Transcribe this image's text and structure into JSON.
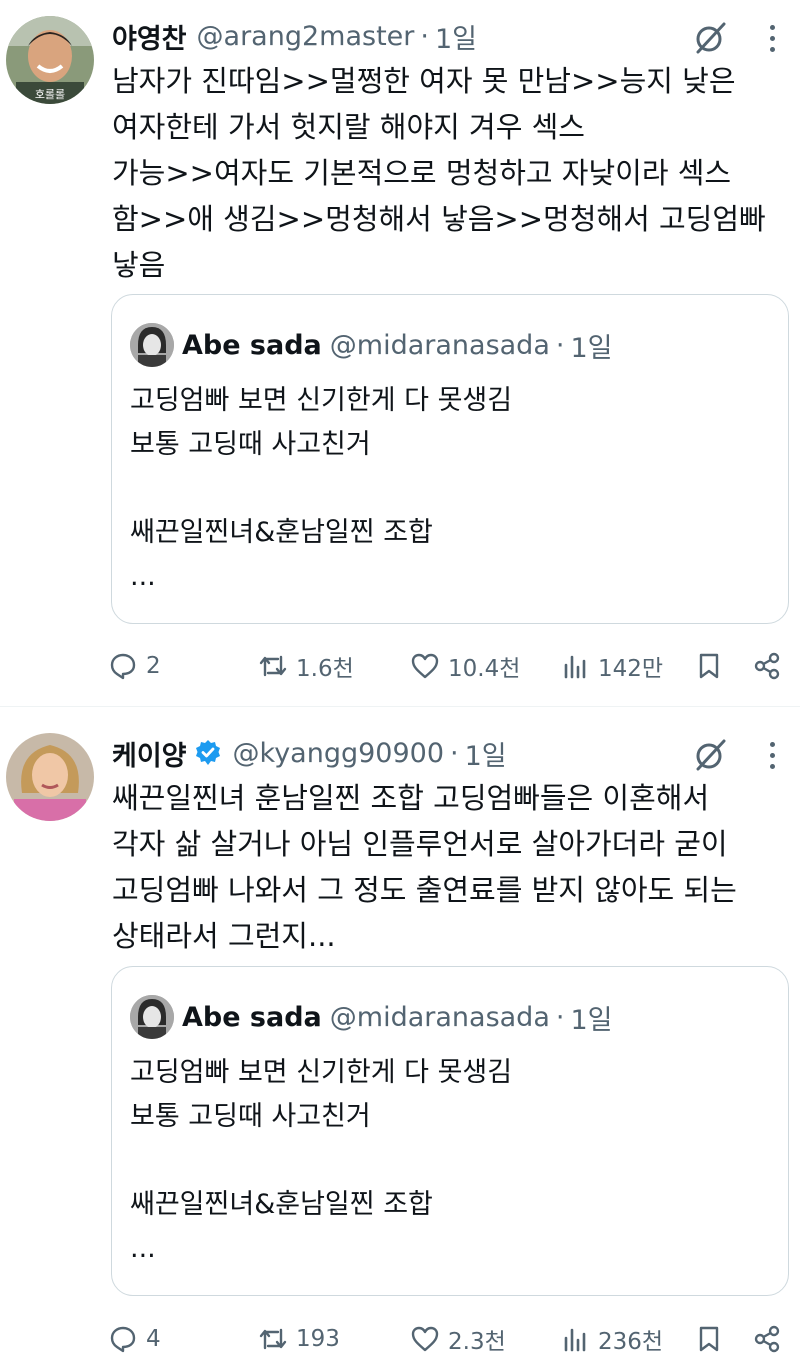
{
  "tweets": [
    {
      "author": {
        "name": "야영찬",
        "handle": "@arang2master",
        "time": "1일",
        "verified": false,
        "avatar_caption": "호롤롤"
      },
      "text": "남자가 진따임>>멀쩡한 여자 못 만남>>능지 낮은\n여자한테 가서 헛지랄 해야지 겨우 섹스\n가능>>여자도 기본적으로 멍청하고 자낮이라 섹스\n함>>애 생김>>멍청해서 낳음>>멍청해서 고딩엄빠\n낳음",
      "quote": {
        "author": {
          "name": "Abe sada",
          "handle": "@midaranasada",
          "time": "1일"
        },
        "text": "고딩엄빠 보면 신기한게 다 못생김\n보통 고딩때 사고친거\n\n쌔끈일찐녀&훈남일찐 조합\n..."
      },
      "stats": {
        "replies": "2",
        "retweets": "1.6천",
        "likes": "10.4천",
        "views": "142만"
      }
    },
    {
      "author": {
        "name": "케이양",
        "handle": "@kyangg90900",
        "time": "1일",
        "verified": true
      },
      "text": "쌔끈일찐녀 훈남일찐 조합 고딩엄빠들은 이혼해서\n각자 삶 살거나 아님 인플루언서로 살아가더라 굳이\n고딩엄빠 나와서 그 정도 출연료를 받지 않아도 되는\n상태라서 그런지...",
      "quote": {
        "author": {
          "name": "Abe sada",
          "handle": "@midaranasada",
          "time": "1일"
        },
        "text": "고딩엄빠 보면 신기한게 다 못생김\n보통 고딩때 사고친거\n\n쌔끈일찐녀&훈남일찐 조합\n..."
      },
      "stats": {
        "replies": "4",
        "retweets": "193",
        "likes": "2.3천",
        "views": "236천"
      }
    }
  ],
  "separator": "·",
  "icons": {
    "reply": "reply-icon",
    "retweet": "retweet-icon",
    "like": "heart-icon",
    "views": "views-icon",
    "bookmark": "bookmark-icon",
    "share": "share-icon",
    "grok": "grok-icon",
    "more": "more-icon",
    "verified": "verified-badge-icon"
  },
  "colors": {
    "text": "#0f1419",
    "secondary": "#536471",
    "border": "#cfd9de",
    "verified": "#1d9bf0"
  }
}
